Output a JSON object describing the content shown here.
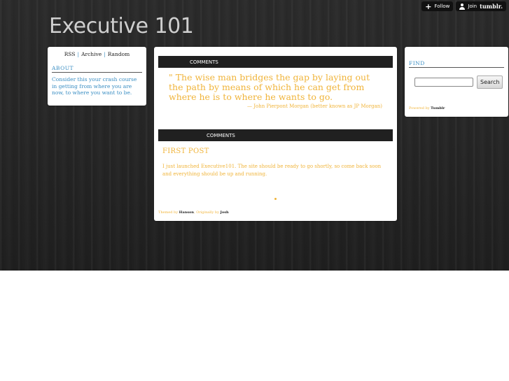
{
  "topbar": {
    "follow": "Follow",
    "join": "Join",
    "brand": "tumblr."
  },
  "site": {
    "title": "Executive 101"
  },
  "sidebar": {
    "links": [
      "RSS",
      "Archive",
      "Random"
    ],
    "separator": "|",
    "about_heading": "ABOUT",
    "about_text": "Consider this your crash course in getting from where you are now, to where you want to be."
  },
  "posts": [
    {
      "bar_label": "COMMENTS",
      "quote": "\" The wise man bridges the gap by laying out the path by means of which he can get from where he is to where he wants to go.",
      "source": "— John Pierpont Morgan (better known as JP Morgan)"
    },
    {
      "bar_label": "COMMENTS",
      "title": "FIRST POST",
      "body": "I just launched Executive101. The site should be ready to go shortly, so come back soon and everything should be up and running."
    }
  ],
  "credits": {
    "themed_prefix": "Themed by",
    "theme_author": "Hanson",
    "original_prefix": ", Originally by",
    "original_author": "Josh"
  },
  "find": {
    "heading": "FIND",
    "search_value": "",
    "button": "Search",
    "powered_prefix": "Powered by",
    "powered_brand": "Tumblr"
  },
  "colors": {
    "accent_blue": "#3a8ec3",
    "post_text": "#f0b43a",
    "background": "#262626"
  }
}
